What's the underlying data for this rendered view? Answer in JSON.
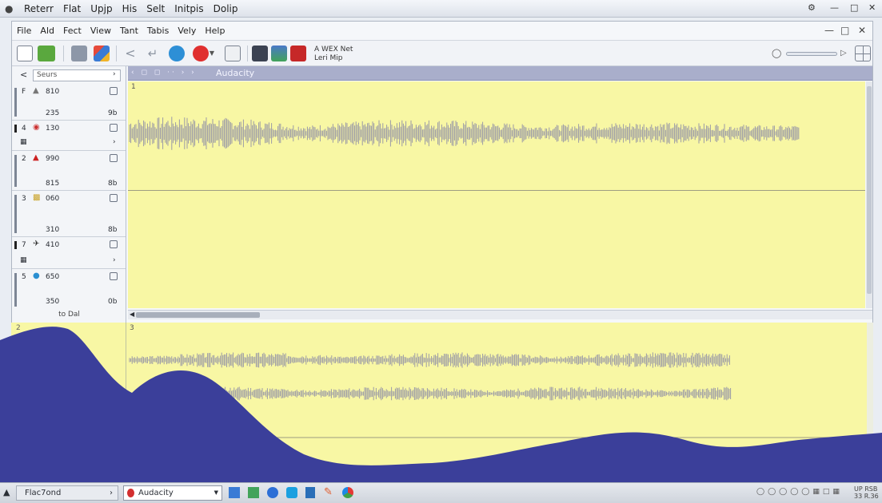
{
  "os_menu": [
    "Reterr",
    "Flat",
    "Upjp",
    "His",
    "Selt",
    "Initpis",
    "Dolip"
  ],
  "window": {
    "menu": [
      "File",
      "Ald",
      "Fect",
      "View",
      "Tant",
      "Tabis",
      "Vely",
      "Help"
    ],
    "toolbar": {
      "project_line1": "A WEX Net",
      "project_line2": "Leri Mip"
    },
    "search_placeholder": "Seurs",
    "tracks": [
      {
        "num": "F",
        "v1": "810",
        "v2": "235",
        "v3": "9b"
      },
      {
        "num": "4",
        "v1": "130",
        "v2": "",
        "v3": ""
      },
      {
        "num": "2",
        "v1": "990",
        "v2": "815",
        "v3": "8b"
      },
      {
        "num": "3",
        "v1": "060",
        "v2": "310",
        "v3": "8b"
      },
      {
        "num": "7",
        "v1": "410",
        "v2": "",
        "v3": ""
      },
      {
        "num": "5",
        "v1": "650",
        "v2": "350",
        "v3": "0b"
      }
    ],
    "tab_title": "Audacity",
    "ruler_label_top": "1",
    "bottom_left_label": "to Dal"
  },
  "lower": {
    "left_label": "2",
    "ruler_label": "3"
  },
  "taskbar": {
    "start_label": "Flac7ond",
    "active_app": "Audacity",
    "tray_line1": "UP RSB",
    "tray_line2": "33 R.36"
  },
  "colors": {
    "wave_bg": "#f8f7a4",
    "wave_fg": "#9b9aa6",
    "mountain": "#3b3f9a",
    "tab_bar": "#a9aecb"
  }
}
